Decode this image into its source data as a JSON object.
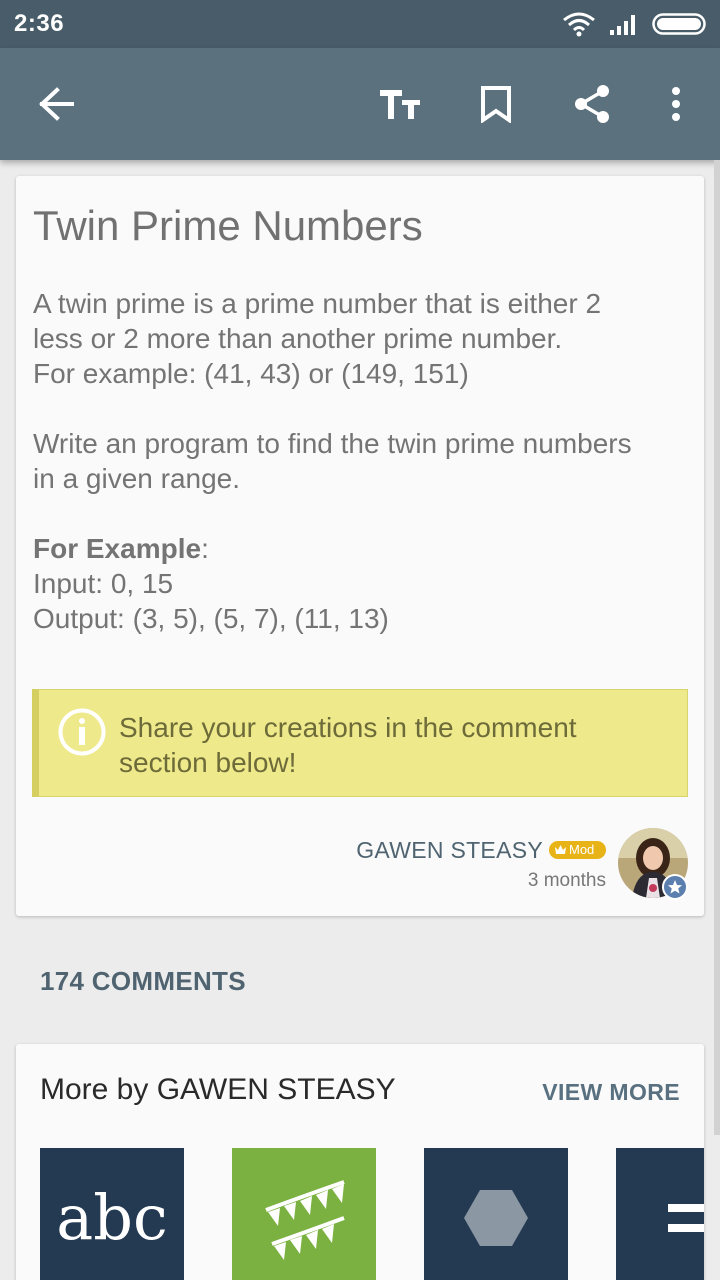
{
  "status_bar": {
    "time": "2:36"
  },
  "app_bar": {
    "icons": [
      "back-arrow-icon",
      "text-size-icon",
      "bookmark-icon",
      "share-icon",
      "more-vert-icon"
    ]
  },
  "article": {
    "title": "Twin Prime Numbers",
    "paragraph1": [
      "A twin prime is a prime number that is either 2",
      "less or 2 more than another prime number.",
      "For example: (41, 43) or (149, 151)"
    ],
    "paragraph2": [
      "Write an program to find the twin prime numbers",
      "in a given range."
    ],
    "example_label": "For Example",
    "example_colon": ":",
    "input_line": "Input: 0, 15",
    "output_line": "Output: (3, 5), (5, 7), (11, 13)",
    "tip": [
      "Share your creations in the comment",
      "section below!"
    ],
    "author": {
      "name": "GAWEN STEASY",
      "badge": "Mod",
      "time": "3 months"
    }
  },
  "comments": {
    "count_label": "174 COMMENTS"
  },
  "more": {
    "title": "More by GAWEN STEASY",
    "view_more": "VIEW MORE",
    "tile1_text": "abc"
  },
  "colors": {
    "status_bar": "#485d69",
    "app_bar": "#5b717e",
    "tip_bg": "#eee98a",
    "mod_badge": "#e8b317",
    "tile_navy": "#243a52",
    "tile_green": "#7ab140"
  }
}
